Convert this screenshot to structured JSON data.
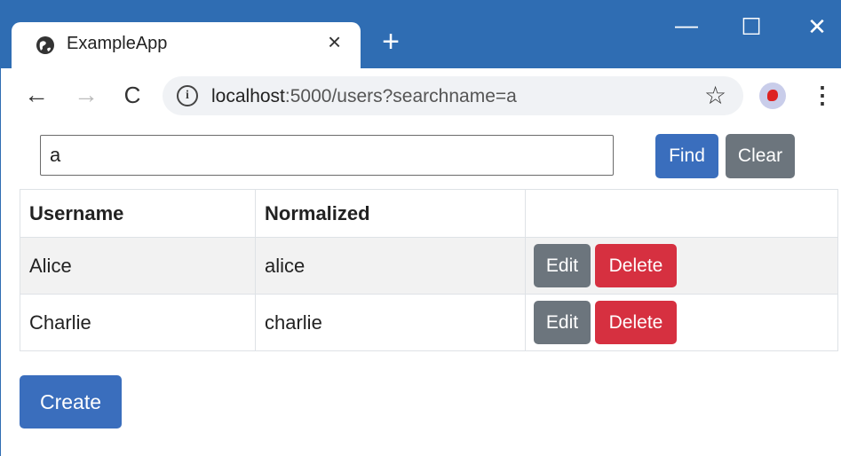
{
  "browser": {
    "tab_title": "ExampleApp",
    "tab_close": "×",
    "new_tab": "+",
    "window_controls": {
      "minimize": "—",
      "maximize": "☐",
      "close": "✕"
    },
    "nav": {
      "back": "←",
      "forward": "→",
      "reload": "C"
    },
    "url_host": "localhost",
    "url_rest": ":5000/users?searchname=a",
    "info_icon": "i",
    "star_icon": "☆",
    "menu_icon": "⋮"
  },
  "search": {
    "value": "a",
    "find_label": "Find",
    "clear_label": "Clear"
  },
  "table": {
    "headers": [
      "Username",
      "Normalized",
      ""
    ],
    "rows": [
      {
        "username": "Alice",
        "normalized": "alice",
        "edit": "Edit",
        "delete": "Delete"
      },
      {
        "username": "Charlie",
        "normalized": "charlie",
        "edit": "Edit",
        "delete": "Delete"
      }
    ]
  },
  "create_label": "Create",
  "colors": {
    "titlebar": "#2f6db3",
    "primary": "#3a6ebd",
    "secondary": "#6c757d",
    "danger": "#d63040"
  }
}
